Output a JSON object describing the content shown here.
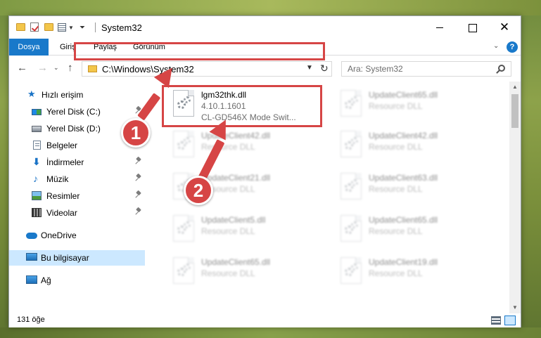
{
  "window": {
    "title": "System32",
    "ribbon_tabs": [
      "Dosya",
      "Giriş",
      "Paylaş",
      "Görünüm"
    ],
    "help_label": "?"
  },
  "address": {
    "path": "C:\\Windows\\System32"
  },
  "search": {
    "placeholder": "Ara: System32"
  },
  "nav": {
    "items": [
      {
        "label": "Hızlı erişim",
        "icon": "star-icon",
        "pinned": false
      },
      {
        "label": "Yerel Disk (C:)",
        "icon": "drive-c-icon",
        "pinned": true
      },
      {
        "label": "Yerel Disk (D:)",
        "icon": "drive-icon",
        "pinned": true
      },
      {
        "label": "Belgeler",
        "icon": "documents-icon",
        "pinned": true
      },
      {
        "label": "İndirmeler",
        "icon": "downloads-icon",
        "pinned": true
      },
      {
        "label": "Müzik",
        "icon": "music-icon",
        "pinned": true
      },
      {
        "label": "Resimler",
        "icon": "pictures-icon",
        "pinned": true
      },
      {
        "label": "Videolar",
        "icon": "videos-icon",
        "pinned": true
      },
      {
        "label": "OneDrive",
        "icon": "onedrive-icon",
        "pinned": false
      },
      {
        "label": "Bu bilgisayar",
        "icon": "this-pc-icon",
        "pinned": false
      },
      {
        "label": "Ağ",
        "icon": "network-icon",
        "pinned": false
      }
    ]
  },
  "files": [
    {
      "name": "lgm32thk.dll",
      "line2": "4.10.1.1601",
      "line3": "CL-GD546X Mode Swit...",
      "blurred": false
    },
    {
      "name": "UpdateClient65.dll",
      "line2": "Resource DLL",
      "line3": "",
      "blurred": true
    },
    {
      "name": "UpdateClient42.dll",
      "line2": "Resource DLL",
      "line3": "",
      "blurred": true
    },
    {
      "name": "UpdateClient42.dll",
      "line2": "Resource DLL",
      "line3": "",
      "blurred": true
    },
    {
      "name": "UpdateClient21.dll",
      "line2": "Resource DLL",
      "line3": "",
      "blurred": true
    },
    {
      "name": "UpdateClient63.dll",
      "line2": "Resource DLL",
      "line3": "",
      "blurred": true
    },
    {
      "name": "UpdateClient5.dll",
      "line2": "Resource DLL",
      "line3": "",
      "blurred": true
    },
    {
      "name": "UpdateClient65.dll",
      "line2": "Resource DLL",
      "line3": "",
      "blurred": true
    },
    {
      "name": "UpdateClient65.dll",
      "line2": "Resource DLL",
      "line3": "",
      "blurred": true
    },
    {
      "name": "UpdateClient19.dll",
      "line2": "Resource DLL",
      "line3": "",
      "blurred": true
    }
  ],
  "status": {
    "count": "131 öğe"
  },
  "annotations": {
    "badge1": "1",
    "badge2": "2",
    "color": "#d64545"
  },
  "colors": {
    "accent": "#1979ca",
    "selection": "#cce8ff"
  }
}
